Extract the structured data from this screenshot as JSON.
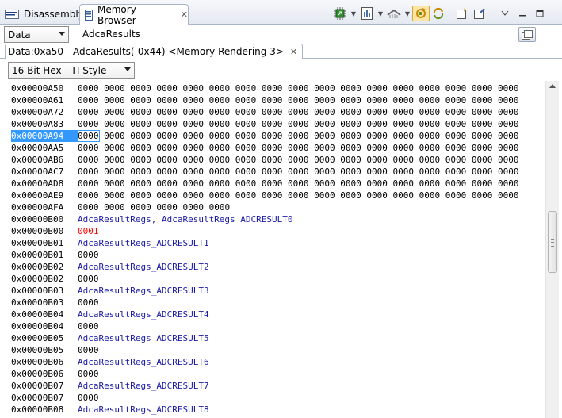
{
  "tabs": {
    "disassembly": "Disassembly",
    "memory_browser": "Memory Browser"
  },
  "page_select": {
    "value": "Data"
  },
  "expression": {
    "value": "AdcaResults"
  },
  "rendering_tab": {
    "label": "Data:0xa50 - AdcaResults(-0x44) <Memory Rendering 3>"
  },
  "format_select": {
    "value": "16-Bit Hex - TI Style"
  },
  "memory_rows": [
    {
      "address": "0x00000A50",
      "kind": "values",
      "values": [
        "0000",
        "0000",
        "0000",
        "0000",
        "0000",
        "0000",
        "0000",
        "0000",
        "0000",
        "0000",
        "0000",
        "0000",
        "0000",
        "0000",
        "0000",
        "0000",
        "0000"
      ]
    },
    {
      "address": "0x00000A61",
      "kind": "values",
      "values": [
        "0000",
        "0000",
        "0000",
        "0000",
        "0000",
        "0000",
        "0000",
        "0000",
        "0000",
        "0000",
        "0000",
        "0000",
        "0000",
        "0000",
        "0000",
        "0000",
        "0000"
      ]
    },
    {
      "address": "0x00000A72",
      "kind": "values",
      "values": [
        "0000",
        "0000",
        "0000",
        "0000",
        "0000",
        "0000",
        "0000",
        "0000",
        "0000",
        "0000",
        "0000",
        "0000",
        "0000",
        "0000",
        "0000",
        "0000",
        "0000"
      ]
    },
    {
      "address": "0x00000A83",
      "kind": "values",
      "values": [
        "0000",
        "0000",
        "0000",
        "0000",
        "0000",
        "0000",
        "0000",
        "0000",
        "0000",
        "0000",
        "0000",
        "0000",
        "0000",
        "0000",
        "0000",
        "0000",
        "0000"
      ]
    },
    {
      "address": "0x00000A94",
      "kind": "values",
      "selected": true,
      "values": [
        "0000",
        "0000",
        "0000",
        "0000",
        "0000",
        "0000",
        "0000",
        "0000",
        "0000",
        "0000",
        "0000",
        "0000",
        "0000",
        "0000",
        "0000",
        "0000",
        "0000"
      ]
    },
    {
      "address": "0x00000AA5",
      "kind": "values",
      "values": [
        "0000",
        "0000",
        "0000",
        "0000",
        "0000",
        "0000",
        "0000",
        "0000",
        "0000",
        "0000",
        "0000",
        "0000",
        "0000",
        "0000",
        "0000",
        "0000",
        "0000"
      ]
    },
    {
      "address": "0x00000AB6",
      "kind": "values",
      "values": [
        "0000",
        "0000",
        "0000",
        "0000",
        "0000",
        "0000",
        "0000",
        "0000",
        "0000",
        "0000",
        "0000",
        "0000",
        "0000",
        "0000",
        "0000",
        "0000",
        "0000"
      ]
    },
    {
      "address": "0x00000AC7",
      "kind": "values",
      "values": [
        "0000",
        "0000",
        "0000",
        "0000",
        "0000",
        "0000",
        "0000",
        "0000",
        "0000",
        "0000",
        "0000",
        "0000",
        "0000",
        "0000",
        "0000",
        "0000",
        "0000"
      ]
    },
    {
      "address": "0x00000AD8",
      "kind": "values",
      "values": [
        "0000",
        "0000",
        "0000",
        "0000",
        "0000",
        "0000",
        "0000",
        "0000",
        "0000",
        "0000",
        "0000",
        "0000",
        "0000",
        "0000",
        "0000",
        "0000",
        "0000"
      ]
    },
    {
      "address": "0x00000AE9",
      "kind": "values",
      "values": [
        "0000",
        "0000",
        "0000",
        "0000",
        "0000",
        "0000",
        "0000",
        "0000",
        "0000",
        "0000",
        "0000",
        "0000",
        "0000",
        "0000",
        "0000",
        "0000",
        "0000"
      ]
    },
    {
      "address": "0x00000AFA",
      "kind": "values",
      "values": [
        "0000",
        "0000",
        "0000",
        "0000",
        "0000",
        "0000"
      ]
    },
    {
      "address": "0x00000B00",
      "kind": "symbol",
      "text": "AdcaResultRegs, AdcaResultRegs_ADCRESULT0"
    },
    {
      "address": "0x00000B00",
      "kind": "values",
      "changed": true,
      "values": [
        "0001"
      ]
    },
    {
      "address": "0x00000B01",
      "kind": "symbol",
      "text": "AdcaResultRegs_ADCRESULT1"
    },
    {
      "address": "0x00000B01",
      "kind": "values",
      "values": [
        "0000"
      ]
    },
    {
      "address": "0x00000B02",
      "kind": "symbol",
      "text": "AdcaResultRegs_ADCRESULT2"
    },
    {
      "address": "0x00000B02",
      "kind": "values",
      "values": [
        "0000"
      ]
    },
    {
      "address": "0x00000B03",
      "kind": "symbol",
      "text": "AdcaResultRegs_ADCRESULT3"
    },
    {
      "address": "0x00000B03",
      "kind": "values",
      "values": [
        "0000"
      ]
    },
    {
      "address": "0x00000B04",
      "kind": "symbol",
      "text": "AdcaResultRegs_ADCRESULT4"
    },
    {
      "address": "0x00000B04",
      "kind": "values",
      "values": [
        "0000"
      ]
    },
    {
      "address": "0x00000B05",
      "kind": "symbol",
      "text": "AdcaResultRegs_ADCRESULT5"
    },
    {
      "address": "0x00000B05",
      "kind": "values",
      "values": [
        "0000"
      ]
    },
    {
      "address": "0x00000B06",
      "kind": "symbol",
      "text": "AdcaResultRegs_ADCRESULT6"
    },
    {
      "address": "0x00000B06",
      "kind": "values",
      "values": [
        "0000"
      ]
    },
    {
      "address": "0x00000B07",
      "kind": "symbol",
      "text": "AdcaResultRegs_ADCRESULT7"
    },
    {
      "address": "0x00000B07",
      "kind": "values",
      "values": [
        "0000"
      ]
    },
    {
      "address": "0x00000B08",
      "kind": "symbol",
      "text": "AdcaResultRegs_ADCRESULT8"
    }
  ],
  "colors": {
    "selection": "#3399ff",
    "changed_value": "#ff0000",
    "symbol": "#1a1aa6"
  }
}
